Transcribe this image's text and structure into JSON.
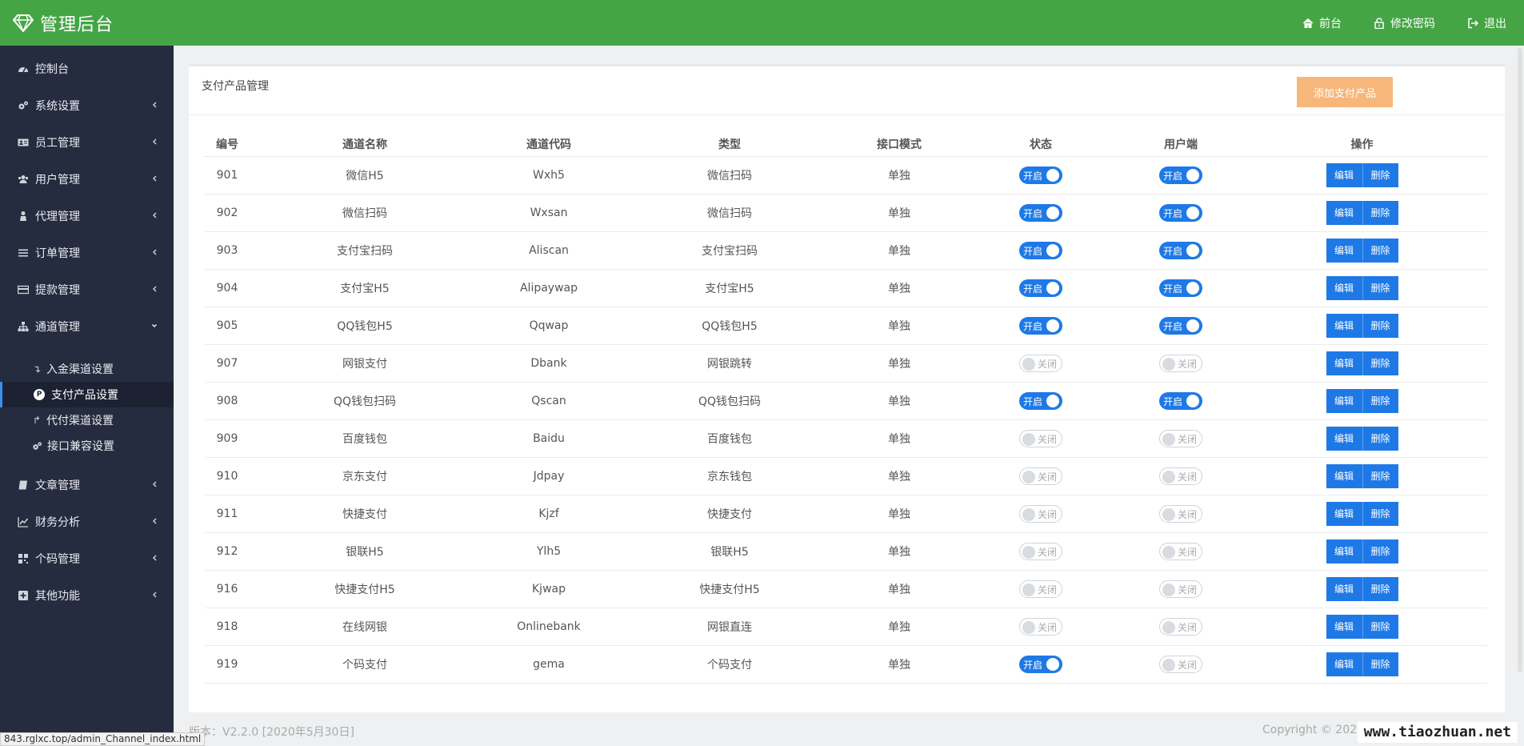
{
  "brand": {
    "title": "管理后台",
    "icon": "diamond-icon"
  },
  "topnav": [
    {
      "label": "前台",
      "icon": "home-icon"
    },
    {
      "label": "修改密码",
      "icon": "lock-icon"
    },
    {
      "label": "退出",
      "icon": "logout-icon"
    }
  ],
  "sidebar": {
    "items": [
      {
        "label": "控制台",
        "icon": "dashboard-icon"
      },
      {
        "label": "系统设置",
        "icon": "gears-icon"
      },
      {
        "label": "员工管理",
        "icon": "id-card-icon"
      },
      {
        "label": "用户管理",
        "icon": "users-icon"
      },
      {
        "label": "代理管理",
        "icon": "agent-icon"
      },
      {
        "label": "订单管理",
        "icon": "list-icon"
      },
      {
        "label": "提款管理",
        "icon": "card-icon"
      },
      {
        "label": "通道管理",
        "icon": "sitemap-icon"
      }
    ],
    "sub_items": [
      {
        "label": "入金渠道设置",
        "icon": "arrow-down-icon"
      },
      {
        "label": "支付产品设置",
        "icon": "p-icon"
      },
      {
        "label": "代付渠道设置",
        "icon": "arrow-up-icon"
      },
      {
        "label": "接口兼容设置",
        "icon": "gears-icon"
      }
    ],
    "items_after": [
      {
        "label": "文章管理",
        "icon": "book-icon"
      },
      {
        "label": "财务分析",
        "icon": "chart-icon"
      },
      {
        "label": "个码管理",
        "icon": "qrcode-icon"
      },
      {
        "label": "其他功能",
        "icon": "plus-square-icon"
      }
    ]
  },
  "panel": {
    "title": "支付产品管理",
    "add_button": "添加支付产品"
  },
  "table": {
    "headers": [
      "编号",
      "通道名称",
      "通道代码",
      "类型",
      "接口模式",
      "状态",
      "用户端",
      "操作"
    ],
    "rows": [
      {
        "id": "901",
        "name": "微信H5",
        "code": "Wxh5",
        "type": "微信扫码",
        "mode": "单独",
        "status": "开启",
        "client": "开启"
      },
      {
        "id": "902",
        "name": "微信扫码",
        "code": "Wxsan",
        "type": "微信扫码",
        "mode": "单独",
        "status": "开启",
        "client": "开启"
      },
      {
        "id": "903",
        "name": "支付宝扫码",
        "code": "Aliscan",
        "type": "支付宝扫码",
        "mode": "单独",
        "status": "开启",
        "client": "开启"
      },
      {
        "id": "904",
        "name": "支付宝H5",
        "code": "Alipaywap",
        "type": "支付宝H5",
        "mode": "单独",
        "status": "开启",
        "client": "开启"
      },
      {
        "id": "905",
        "name": "QQ钱包H5",
        "code": "Qqwap",
        "type": "QQ钱包H5",
        "mode": "单独",
        "status": "开启",
        "client": "开启"
      },
      {
        "id": "907",
        "name": "网银支付",
        "code": "Dbank",
        "type": "网银跳转",
        "mode": "单独",
        "status": "关闭",
        "client": "关闭"
      },
      {
        "id": "908",
        "name": "QQ钱包扫码",
        "code": "Qscan",
        "type": "QQ钱包扫码",
        "mode": "单独",
        "status": "开启",
        "client": "开启"
      },
      {
        "id": "909",
        "name": "百度钱包",
        "code": "Baidu",
        "type": "百度钱包",
        "mode": "单独",
        "status": "关闭",
        "client": "关闭"
      },
      {
        "id": "910",
        "name": "京东支付",
        "code": "Jdpay",
        "type": "京东钱包",
        "mode": "单独",
        "status": "关闭",
        "client": "关闭"
      },
      {
        "id": "911",
        "name": "快捷支付",
        "code": "Kjzf",
        "type": "快捷支付",
        "mode": "单独",
        "status": "关闭",
        "client": "关闭"
      },
      {
        "id": "912",
        "name": "银联H5",
        "code": "Ylh5",
        "type": "银联H5",
        "mode": "单独",
        "status": "关闭",
        "client": "关闭"
      },
      {
        "id": "916",
        "name": "快捷支付H5",
        "code": "Kjwap",
        "type": "快捷支付H5",
        "mode": "单独",
        "status": "关闭",
        "client": "关闭"
      },
      {
        "id": "918",
        "name": "在线网银",
        "code": "Onlinebank",
        "type": "网银直连",
        "mode": "单独",
        "status": "关闭",
        "client": "关闭"
      },
      {
        "id": "919",
        "name": "个码支付",
        "code": "gema",
        "type": "个码支付",
        "mode": "单独",
        "status": "开启",
        "client": "关闭"
      }
    ],
    "edit_label": "编辑",
    "delete_label": "删除",
    "on_label": "开启"
  },
  "footer": {
    "version": "版本：V2.2.0 [2020年5月30日]",
    "copyright": "Copyright © 2020"
  },
  "status_url": "843.rglxc.top/admin_Channel_index.html",
  "watermark": "www.tiaozhuan.net",
  "colors": {
    "topbar": "#45a545",
    "sidebar": "#262c3f",
    "primary": "#1e79e6",
    "add_button": "#f8b77a"
  }
}
